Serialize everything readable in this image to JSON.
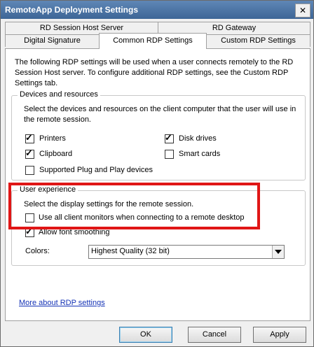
{
  "window": {
    "title": "RemoteApp Deployment Settings",
    "close": "✕"
  },
  "tabs": {
    "row1": [
      "RD Session Host Server",
      "RD Gateway"
    ],
    "row2": [
      "Digital Signature",
      "Common RDP Settings",
      "Custom RDP Settings"
    ]
  },
  "intro": "The following RDP settings will be used when a user connects remotely to the RD Session Host server.  To configure additional RDP settings, see the Custom RDP Settings tab.",
  "devices": {
    "title": "Devices and resources",
    "description": "Select the devices and resources on the client computer that the user will use in the remote session.",
    "items": [
      {
        "label": "Printers",
        "checked": true
      },
      {
        "label": "Disk drives",
        "checked": true
      },
      {
        "label": "Clipboard",
        "checked": true
      },
      {
        "label": "Smart cards",
        "checked": false
      },
      {
        "label": "Supported Plug and Play devices",
        "checked": false
      }
    ]
  },
  "experience": {
    "title": "User experience",
    "description": "Select the display settings for the remote session.",
    "monitors": {
      "label": "Use all client monitors when connecting to a remote desktop",
      "checked": false
    },
    "smoothing": {
      "label": "Allow font smoothing",
      "checked": true
    },
    "colors_label": "Colors:",
    "colors_value": "Highest Quality (32 bit)"
  },
  "link": "More about RDP settings",
  "buttons": {
    "ok": "OK",
    "cancel": "Cancel",
    "apply": "Apply"
  },
  "highlight_color": "#e01616"
}
